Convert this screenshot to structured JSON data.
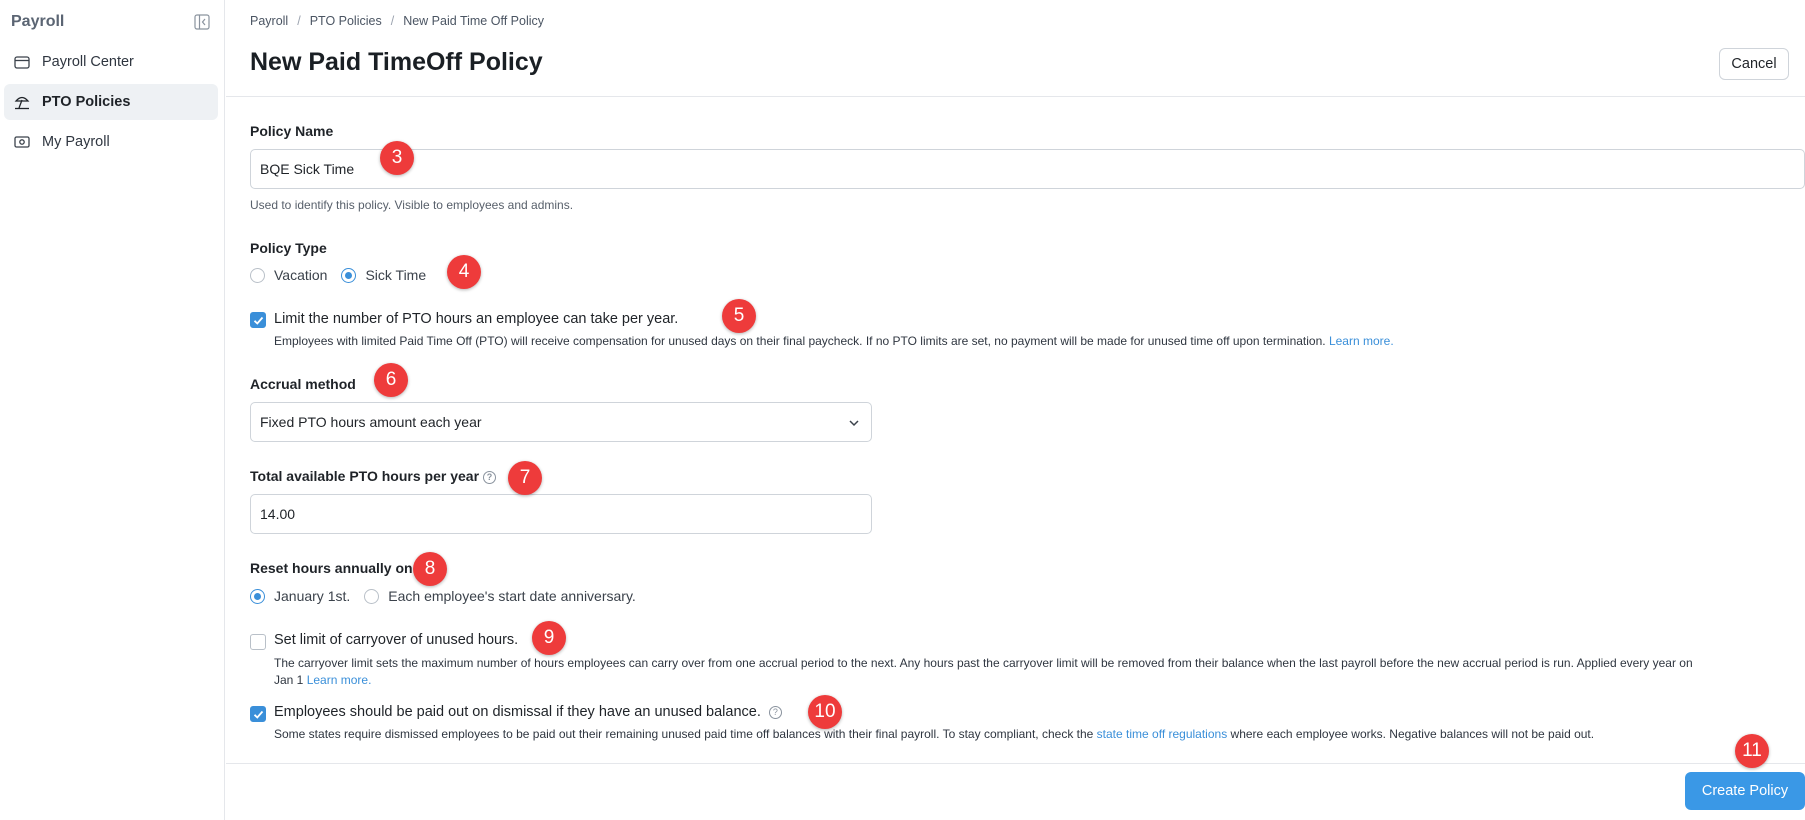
{
  "sidebar": {
    "title": "Payroll",
    "items": [
      {
        "label": "Payroll Center",
        "icon": "wallet-icon",
        "active": false
      },
      {
        "label": "PTO Policies",
        "icon": "beach-umbrella-icon",
        "active": true
      },
      {
        "label": "My Payroll",
        "icon": "cash-icon",
        "active": false
      }
    ]
  },
  "breadcrumb": [
    "Payroll",
    "PTO Policies",
    "New Paid Time Off Policy"
  ],
  "header": {
    "title": "New Paid TimeOff Policy",
    "cancel_label": "Cancel"
  },
  "form": {
    "policy_name": {
      "label": "Policy Name",
      "value": "BQE Sick Time",
      "help": "Used to identify this policy. Visible to employees and admins."
    },
    "policy_type": {
      "label": "Policy Type",
      "options": [
        "Vacation",
        "Sick Time"
      ],
      "selected": "Sick Time"
    },
    "limit_hours": {
      "checked": true,
      "label": "Limit the number of PTO hours an employee can take per year.",
      "desc": "Employees with limited Paid Time Off (PTO) will receive compensation for unused days on their final paycheck. If no PTO limits are set, no payment will be made for unused time off upon termination.",
      "link": "Learn more."
    },
    "accrual": {
      "label": "Accrual method",
      "value": "Fixed PTO hours amount each year"
    },
    "total_hours": {
      "label": "Total available PTO hours per year",
      "value": "14.00"
    },
    "reset": {
      "label": "Reset hours annually on",
      "options": [
        "January 1st.",
        "Each employee's start date anniversary."
      ],
      "selected": "January 1st."
    },
    "carryover": {
      "checked": false,
      "label": "Set limit of carryover of unused hours.",
      "desc_line1": "The carryover limit sets the maximum number of hours employees can carry over from one accrual period to the next. Any hours past the carryover limit will be removed from their balance when the last payroll before the new accrual period is run. Applied every year on",
      "desc_line2": "Jan 1",
      "link": "Learn more."
    },
    "payout": {
      "checked": true,
      "label": "Employees should be paid out on dismissal if they have an unused balance.",
      "desc_pre": "Some states require dismissed employees to be paid out their remaining unused paid time off balances with their final payroll. To stay compliant, check the",
      "link": "state time off regulations",
      "desc_post": "where each employee works. Negative balances will not be paid out."
    }
  },
  "markers": [
    "3",
    "4",
    "5",
    "6",
    "7",
    "8",
    "9",
    "10",
    "11"
  ],
  "footer": {
    "create_label": "Create Policy"
  },
  "colors": {
    "accent": "#3a98e6",
    "marker": "#ee3b3b"
  }
}
